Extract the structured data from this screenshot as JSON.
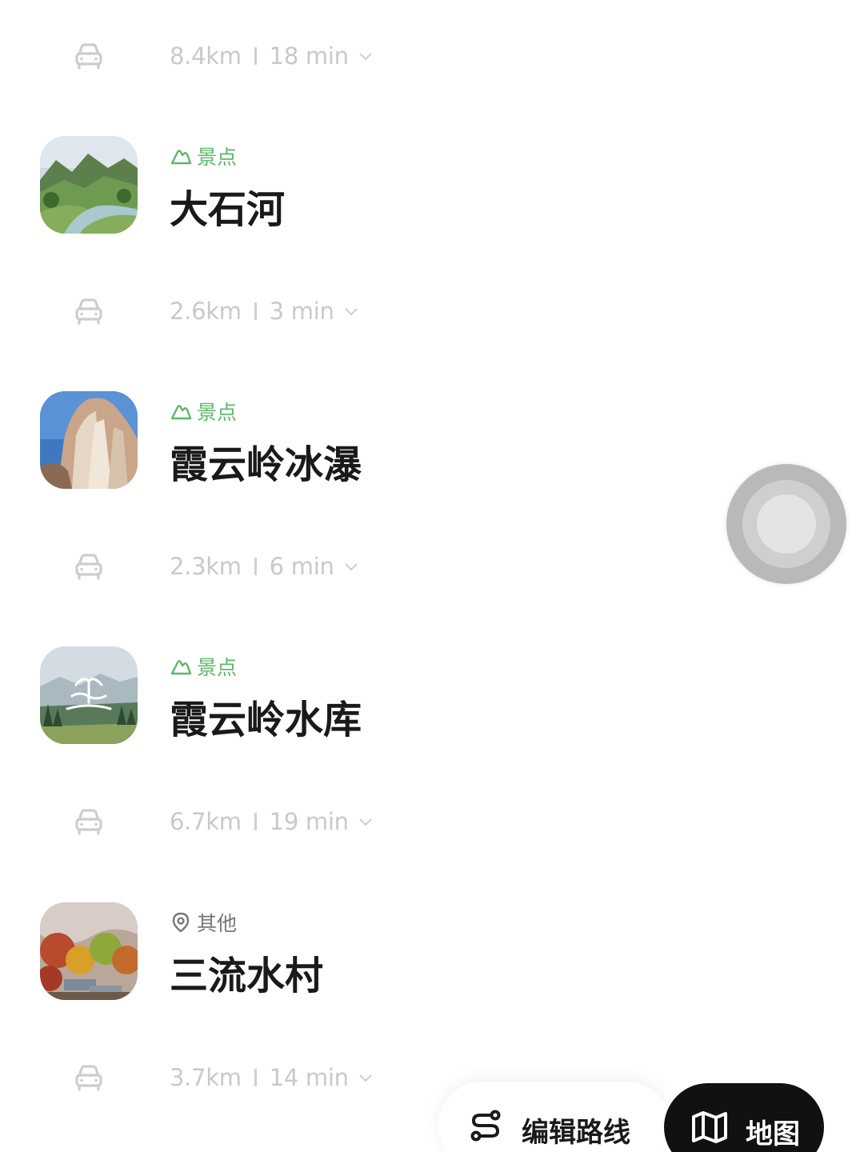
{
  "segments": [
    {
      "distance": "8.4km",
      "duration": "18 min"
    },
    {
      "distance": "2.6km",
      "duration": "3 min"
    },
    {
      "distance": "2.3km",
      "duration": "6 min"
    },
    {
      "distance": "6.7km",
      "duration": "19 min"
    },
    {
      "distance": "3.7km",
      "duration": "14 min"
    }
  ],
  "places": [
    {
      "category": "景点",
      "category_icon": "mountain-icon",
      "name": "大石河"
    },
    {
      "category": "景点",
      "category_icon": "mountain-icon",
      "name": "霞云岭冰瀑"
    },
    {
      "category": "景点",
      "category_icon": "mountain-icon",
      "name": "霞云岭水库"
    },
    {
      "category": "其他",
      "category_icon": "location-pin-icon",
      "name": "三流水村"
    }
  ],
  "actions": {
    "edit_route_label": "编辑路线",
    "map_label": "地图"
  },
  "colors": {
    "scenic_tag": "#5cb86a",
    "muted_text": "#c9c9c9",
    "map_button_bg": "#111111"
  }
}
